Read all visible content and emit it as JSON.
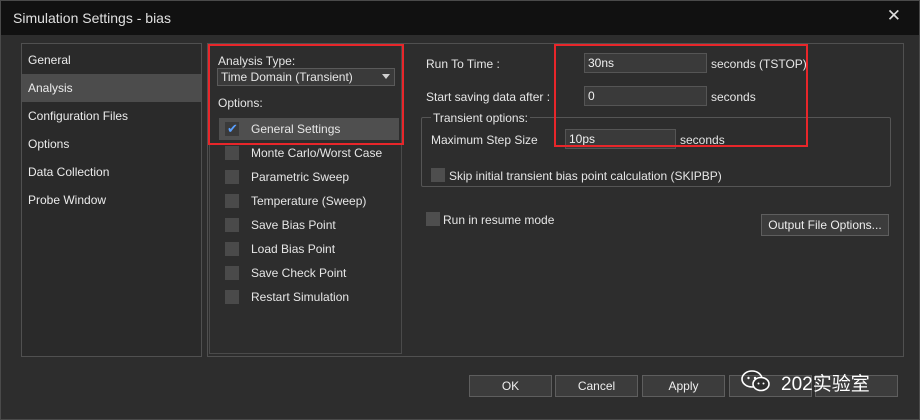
{
  "window": {
    "title": "Simulation Settings - bias",
    "close_glyph": "✕"
  },
  "sidebar": {
    "items": [
      {
        "label": "General"
      },
      {
        "label": "Analysis",
        "active": true
      },
      {
        "label": "Configuration Files"
      },
      {
        "label": "Options"
      },
      {
        "label": "Data Collection"
      },
      {
        "label": "Probe Window"
      }
    ]
  },
  "analysis": {
    "type_label": "Analysis Type:",
    "type_value": "Time Domain (Transient)",
    "options_label": "Options:",
    "options": [
      {
        "label": "General Settings",
        "checked": true,
        "selected": true
      },
      {
        "label": "Monte Carlo/Worst Case",
        "checked": false
      },
      {
        "label": "Parametric Sweep",
        "checked": false
      },
      {
        "label": "Temperature (Sweep)",
        "checked": false
      },
      {
        "label": "Save Bias Point",
        "checked": false
      },
      {
        "label": "Load Bias Point",
        "checked": false
      },
      {
        "label": "Save Check Point",
        "checked": false
      },
      {
        "label": "Restart Simulation",
        "checked": false
      }
    ]
  },
  "settings": {
    "run_to_time_label": "Run To Time :",
    "run_to_time_value": "30ns",
    "run_to_time_unit": "seconds (TSTOP)",
    "start_saving_label": "Start saving data after :",
    "start_saving_value": "0",
    "start_saving_unit": "seconds",
    "transient_options_label": "Transient options:",
    "max_step_label": "Maximum Step Size",
    "max_step_value": "10ps",
    "max_step_unit": "seconds",
    "skip_bias_label": "Skip initial transient bias point calculation (SKIPBP)",
    "resume_label": "Run in resume mode",
    "output_file_options_label": "Output File Options..."
  },
  "buttons": {
    "ok": "OK",
    "cancel": "Cancel",
    "apply": "Apply"
  },
  "watermark": {
    "text": "202实验室",
    "icon": "wechat-icon"
  },
  "colors": {
    "highlight_red": "#e8262a",
    "check_blue": "#5aa0ff"
  }
}
